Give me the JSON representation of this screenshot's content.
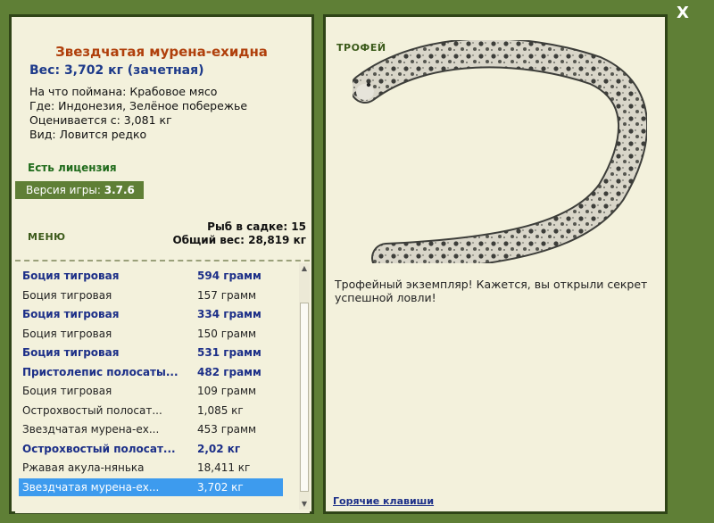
{
  "close_label": "X",
  "catch": {
    "title": "Звездчатая мурена-ехидна",
    "weight": "Вес: 3,702 кг (зачетная)",
    "bait": "На что поймана: Крабовое мясо",
    "location": "Где: Индонезия, Зелёное побережье",
    "value": "Оценивается с: 3,081 кг",
    "rarity": "Вид: Ловится редко"
  },
  "license": "Есть лицензия",
  "version": {
    "label": "Версия игры:",
    "value": "3.7.6"
  },
  "menu_label": "МЕНЮ",
  "stats": {
    "count": "Рыб в садке: 15",
    "total": "Общий вес: 28,819 кг"
  },
  "fish_list": [
    {
      "name": "Боция тигровая",
      "weight": "594 грамм",
      "bold": true
    },
    {
      "name": "Боция тигровая",
      "weight": "157 грамм",
      "bold": false
    },
    {
      "name": "Боция тигровая",
      "weight": "334 грамм",
      "bold": true
    },
    {
      "name": "Боция тигровая",
      "weight": "150 грамм",
      "bold": false
    },
    {
      "name": "Боция тигровая",
      "weight": "531 грамм",
      "bold": true
    },
    {
      "name": "Пристолепис полосаты...",
      "weight": "482 грамм",
      "bold": true
    },
    {
      "name": "Боция тигровая",
      "weight": "109 грамм",
      "bold": false
    },
    {
      "name": "Острохвостый полосат...",
      "weight": "1,085 кг",
      "bold": false
    },
    {
      "name": "Звездчатая мурена-ех...",
      "weight": "453 грамм",
      "bold": false
    },
    {
      "name": "Острохвостый полосат...",
      "weight": "2,02 кг",
      "bold": true
    },
    {
      "name": "Ржавая акула-нянька",
      "weight": "18,411 кг",
      "bold": false
    },
    {
      "name": "Звездчатая мурена-ех...",
      "weight": "3,702 кг",
      "bold": false,
      "selected": true
    }
  ],
  "trophy_label": "ТРОФЕЙ",
  "trophy_text": "Трофейный экземпляр! Кажется, вы открыли секрет успешной ловли!",
  "hotkeys_label": "Горячие клавиши",
  "colors": {
    "background": "#5f7f36",
    "panel": "#f3f1dc",
    "title": "#b0400c",
    "accent": "#1c2f88",
    "selected": "#3d9bee"
  }
}
